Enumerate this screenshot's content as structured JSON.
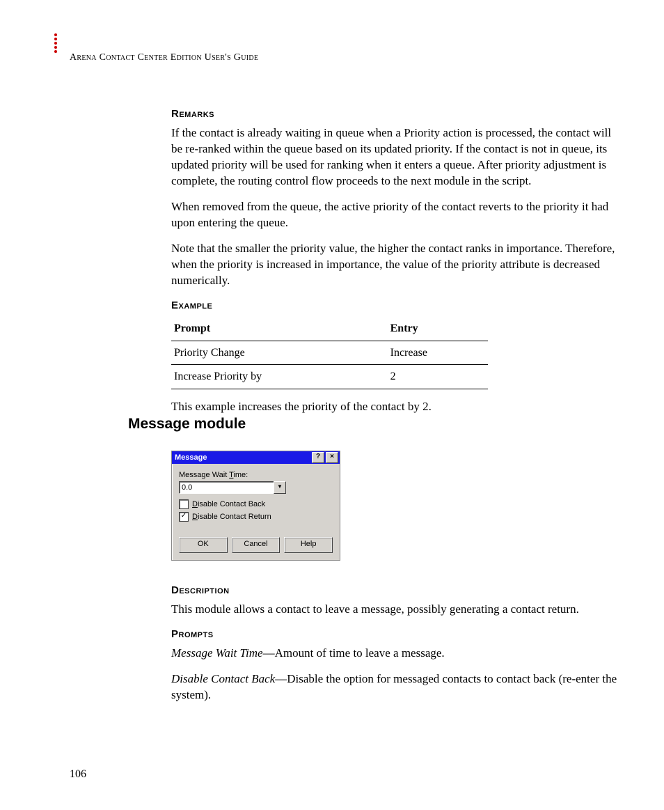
{
  "runningHead": "Arena Contact Center Edition User's Guide",
  "remarks": {
    "heading": "Remarks",
    "p1": "If the contact is already waiting in queue when a Priority action is processed, the contact will be re-ranked within the queue based on its updated priority. If the contact is not in queue, its updated priority will be used for ranking when it enters a queue. After priority adjustment is complete, the routing control flow proceeds to the next module in the script.",
    "p2": "When removed from the queue, the active priority of the contact reverts to the priority it had upon entering the queue.",
    "p3": "Note that the smaller the priority value, the higher the contact ranks in importance. Therefore, when the priority is increased in importance, the value of the priority attribute is decreased numerically."
  },
  "example": {
    "heading": "Example",
    "headers": {
      "col1": "Prompt",
      "col2": "Entry"
    },
    "rows": [
      {
        "prompt": "Priority Change",
        "entry": "Increase"
      },
      {
        "prompt": "Increase Priority by",
        "entry": "2"
      }
    ],
    "caption": "This example increases the priority of the contact by 2."
  },
  "section": {
    "title": "Message module"
  },
  "dialog": {
    "title": "Message",
    "help": "?",
    "close": "×",
    "waitLabel": "Message Wait Time:",
    "waitLabelKey": "T",
    "waitValue": "0.0",
    "dropdownGlyph": "▼",
    "chk1Label": "Disable Contact Back",
    "chk1Key": "D",
    "chk1Checked": false,
    "chk2Label": "Disable Contact Return",
    "chk2Key": "D",
    "chk2Checked": true,
    "checkGlyph": "✓",
    "buttons": {
      "ok": "OK",
      "cancel": "Cancel",
      "help": "Help"
    }
  },
  "description": {
    "heading": "Description",
    "text": "This module allows a contact to leave a message, possibly generating a contact return."
  },
  "prompts": {
    "heading": "Prompts",
    "p1_term": "Message Wait Time",
    "p1_rest": "—Amount of time to leave a message.",
    "p2_term": "Disable Contact Back",
    "p2_rest": "—Disable the option for messaged contacts to contact back (re-enter the system)."
  },
  "pageNumber": "106"
}
